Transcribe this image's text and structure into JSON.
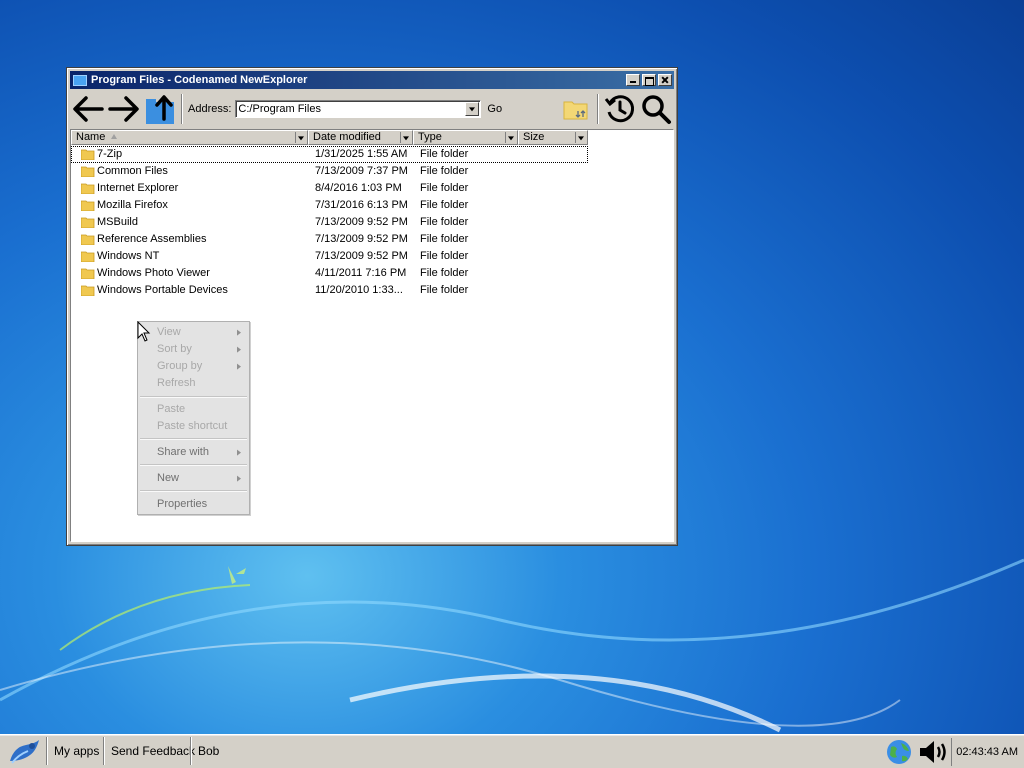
{
  "window": {
    "title": "Program Files - Codenamed NewExplorer",
    "controls": {
      "minimize": "minimize",
      "maximize": "maximize",
      "close": "close"
    }
  },
  "toolbar": {
    "back_icon": "arrow-left-icon",
    "forward_icon": "arrow-right-icon",
    "up_icon": "folder-up-icon",
    "address_label": "Address:",
    "address_value": "C:/Program Files",
    "go_label": "Go",
    "folder_sync_icon": "folder-sync-icon",
    "history_icon": "history-icon",
    "search_icon": "search-icon"
  },
  "list": {
    "columns": [
      "Name",
      "Date modified",
      "Type",
      "Size"
    ],
    "sort_column": "Name",
    "rows": [
      {
        "name": "7-Zip",
        "date": "1/31/2025 1:55 AM",
        "type": "File folder",
        "selected": true
      },
      {
        "name": "Common Files",
        "date": "7/13/2009 7:37 PM",
        "type": "File folder"
      },
      {
        "name": "Internet Explorer",
        "date": "8/4/2016 1:03 PM",
        "type": "File folder"
      },
      {
        "name": "Mozilla Firefox",
        "date": "7/31/2016 6:13 PM",
        "type": "File folder"
      },
      {
        "name": "MSBuild",
        "date": "7/13/2009 9:52 PM",
        "type": "File folder"
      },
      {
        "name": "Reference Assemblies",
        "date": "7/13/2009 9:52 PM",
        "type": "File folder"
      },
      {
        "name": "Windows NT",
        "date": "7/13/2009 9:52 PM",
        "type": "File folder"
      },
      {
        "name": "Windows Photo Viewer",
        "date": "4/11/2011 7:16 PM",
        "type": "File folder"
      },
      {
        "name": "Windows Portable Devices",
        "date": "11/20/2010 1:33...",
        "type": "File folder"
      }
    ]
  },
  "context_menu": {
    "items": [
      {
        "label": "View",
        "submenu": true,
        "enabled": false
      },
      {
        "label": "Sort by",
        "submenu": true,
        "enabled": false
      },
      {
        "label": "Group by",
        "submenu": true,
        "enabled": false
      },
      {
        "label": "Refresh",
        "submenu": false,
        "enabled": false
      },
      {
        "label": "Paste",
        "submenu": false,
        "enabled": false
      },
      {
        "label": "Paste shortcut",
        "submenu": false,
        "enabled": false
      },
      {
        "label": "Share with",
        "submenu": true,
        "enabled": true
      },
      {
        "label": "New",
        "submenu": true,
        "enabled": true
      },
      {
        "label": "Properties",
        "submenu": false,
        "enabled": true
      }
    ]
  },
  "taskbar": {
    "start_icon": "start-logo-icon",
    "buttons": [
      "My apps",
      "Send Feedback",
      "Bob"
    ],
    "tray_icons": [
      "network-globe-icon",
      "volume-icon"
    ],
    "clock": "02:43:43 AM"
  },
  "colors": {
    "titlebar_start": "#0a246a",
    "titlebar_end": "#3a6ea5",
    "chrome": "#d4d0c8",
    "desktop_blue": "#1a6fd0",
    "folder_yellow": "#e8c448"
  }
}
